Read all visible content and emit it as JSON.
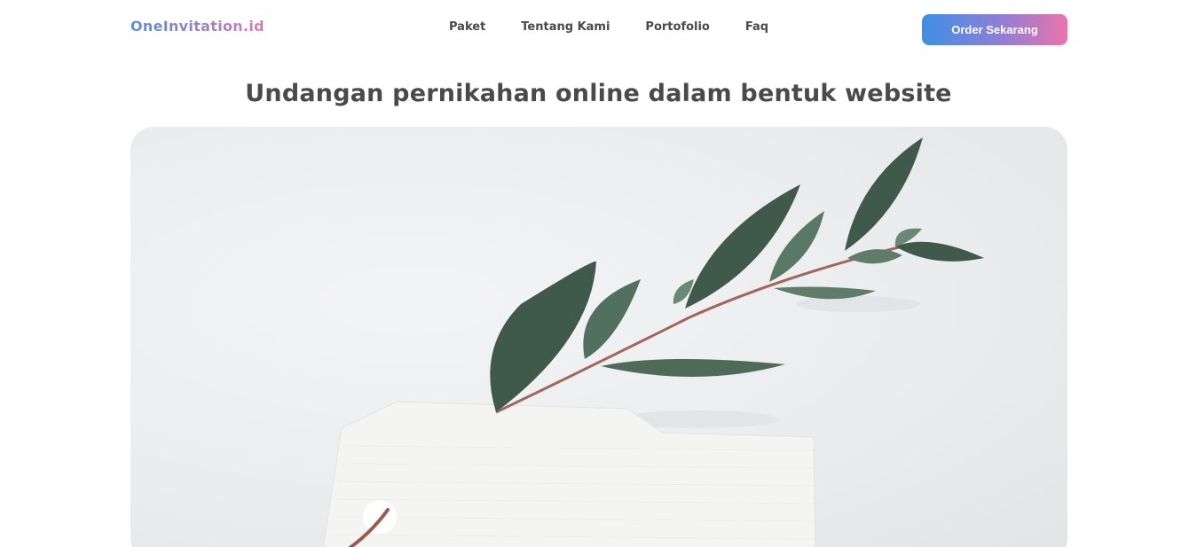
{
  "navbar": {
    "logo": "OneInvitation.id",
    "links": [
      "Paket",
      "Tentang Kami",
      "Portofolio",
      "Faq"
    ],
    "cta_label": "Order Sekarang"
  },
  "hero": {
    "title": "Undangan pernikahan online dalam bentuk website",
    "image_subject": "eucalyptus-branch-with-paper-tag"
  },
  "colors": {
    "gradient_start": "#3f8fe6",
    "gradient_end": "#ea74ac",
    "text": "#4a4a4a"
  }
}
